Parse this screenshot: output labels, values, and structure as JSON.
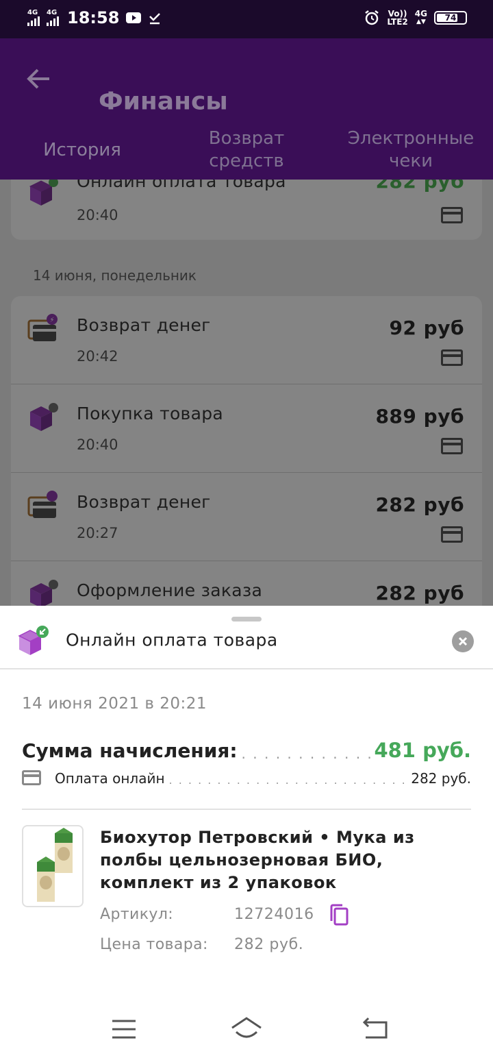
{
  "status_bar": {
    "signal1": "4G",
    "signal2": "4G",
    "time": "18:58",
    "volte_top": "Vo))",
    "volte_bottom": "LTE2",
    "net_top": "4G",
    "net_bottom": "⁺⁄⁻",
    "battery": "74"
  },
  "app_bar": {
    "title": "Финансы",
    "tabs": [
      {
        "label": "История"
      },
      {
        "label": "Возврат\nсредств"
      },
      {
        "label": "Электронные\nчеки"
      }
    ]
  },
  "history": {
    "top_card": {
      "title": "Онлайн оплата товара",
      "time": "20:40",
      "amount": "282 руб"
    },
    "date_header": "14 июня, понедельник",
    "rows": [
      {
        "title": "Возврат денег",
        "time": "20:42",
        "amount": "92 руб",
        "icon": "refund-icon"
      },
      {
        "title": "Покупка товара",
        "time": "20:40",
        "amount": "889 руб",
        "icon": "purchase-box-icon"
      },
      {
        "title": "Возврат денег",
        "time": "20:27",
        "amount": "282 руб",
        "icon": "refund-icon"
      },
      {
        "title": "Оформление заказа",
        "time": "",
        "amount": "282 руб",
        "icon": "purchase-box-icon"
      }
    ]
  },
  "sheet": {
    "title": "Онлайн оплата товара",
    "date": "14 июня 2021 в 20:21",
    "sum_label": "Сумма начисления:",
    "sum_value": "481 руб.",
    "pay_label": "Оплата онлайн",
    "pay_value": "282 руб.",
    "product": {
      "title": "Биохутор Петровский • Мука из полбы цельнозерновая БИО, комплект из 2 упаковок",
      "article_label": "Артикул:",
      "article_value": "12724016",
      "price_label": "Цена товара:",
      "price_value": "282 руб."
    }
  },
  "colors": {
    "app_bar": "#3a0e57",
    "status_bar": "#1b0a2b",
    "accent_purple": "#a33fc4",
    "sum_green": "#46a85a"
  }
}
